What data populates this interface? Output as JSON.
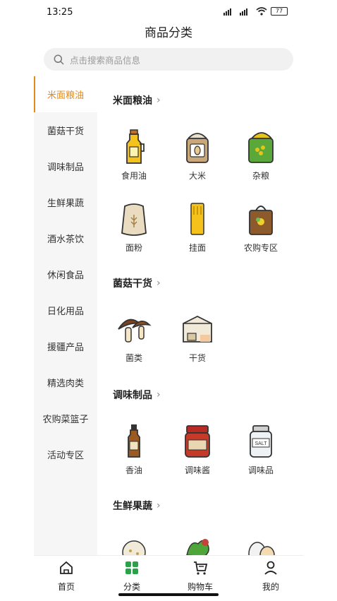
{
  "status": {
    "time": "13:25",
    "battery": "77"
  },
  "header": {
    "title": "商品分类"
  },
  "search": {
    "placeholder": "点击搜索商品信息"
  },
  "sidebar": {
    "items": [
      {
        "label": "米面粮油"
      },
      {
        "label": "菌菇干货"
      },
      {
        "label": "调味制品"
      },
      {
        "label": "生鲜果蔬"
      },
      {
        "label": "酒水茶饮"
      },
      {
        "label": "休闲食品"
      },
      {
        "label": "日化用品"
      },
      {
        "label": "援疆产品"
      },
      {
        "label": "精选肉类"
      },
      {
        "label": "农购菜篮子"
      },
      {
        "label": "活动专区"
      }
    ]
  },
  "sections": [
    {
      "title": "米面粮油",
      "items": [
        {
          "label": "食用油",
          "icon": "oil-bottle-icon"
        },
        {
          "label": "大米",
          "icon": "rice-bag-icon"
        },
        {
          "label": "杂粮",
          "icon": "grain-sack-icon"
        },
        {
          "label": "面粉",
          "icon": "flour-sack-icon"
        },
        {
          "label": "挂面",
          "icon": "noodles-pack-icon"
        },
        {
          "label": "农购专区",
          "icon": "shopping-bag-icon"
        }
      ]
    },
    {
      "title": "菌菇干货",
      "items": [
        {
          "label": "菌类",
          "icon": "mushroom-icon"
        },
        {
          "label": "干货",
          "icon": "box-icon"
        }
      ]
    },
    {
      "title": "调味制品",
      "items": [
        {
          "label": "香油",
          "icon": "sesame-oil-icon"
        },
        {
          "label": "调味酱",
          "icon": "sauce-jar-icon"
        },
        {
          "label": "调味品",
          "icon": "salt-jar-icon"
        }
      ]
    },
    {
      "title": "生鲜果蔬",
      "items": []
    }
  ],
  "salt_label": "SALT",
  "tabbar": {
    "items": [
      {
        "label": "首页"
      },
      {
        "label": "分类"
      },
      {
        "label": "购物车"
      },
      {
        "label": "我的"
      }
    ]
  },
  "colors": {
    "accent": "#e28a1a",
    "active_tab": "#2aa24a"
  }
}
